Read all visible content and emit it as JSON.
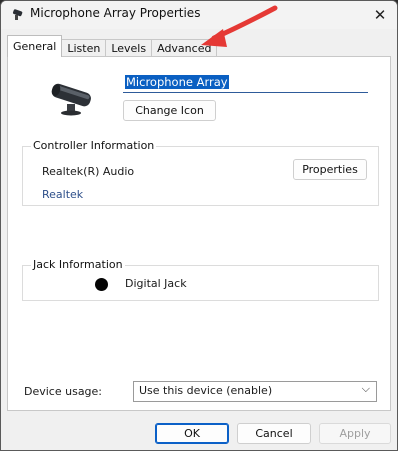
{
  "window": {
    "title": "Microphone Array Properties",
    "close_glyph": "✕"
  },
  "tabs": [
    {
      "label": "General",
      "active": true
    },
    {
      "label": "Listen",
      "active": false
    },
    {
      "label": "Levels",
      "active": false
    },
    {
      "label": "Advanced",
      "active": false
    }
  ],
  "general": {
    "device_name": "Microphone Array",
    "change_icon_label": "Change Icon",
    "controller": {
      "legend": "Controller Information",
      "name": "Realtek(R) Audio",
      "vendor_link": "Realtek",
      "properties_label": "Properties"
    },
    "jack": {
      "legend": "Jack Information",
      "label": "Digital Jack"
    },
    "usage": {
      "label": "Device usage:",
      "selected": "Use this device (enable)",
      "chevron": "⌵"
    }
  },
  "footer": {
    "ok_label": "OK",
    "cancel_label": "Cancel",
    "apply_label": "Apply"
  },
  "colors": {
    "accent": "#0b60c7",
    "annotation_arrow": "#e53935",
    "link": "#2d4f8a"
  },
  "icons": {
    "app": "microphone-array-icon",
    "device": "microphone-array-device-icon",
    "close": "close-icon",
    "jack": "jack-dot-icon",
    "chevron": "chevron-down-icon"
  }
}
